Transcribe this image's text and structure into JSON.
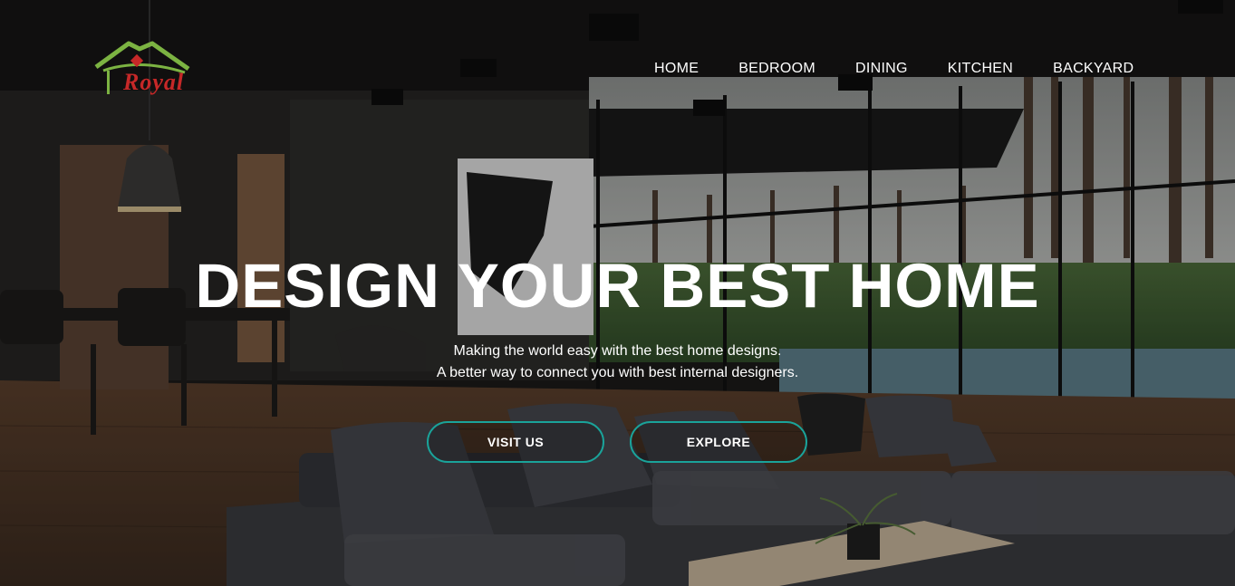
{
  "brand": {
    "logo_text": "Royal",
    "logo_roof_color": "#7cb342",
    "logo_text_color": "#c62828"
  },
  "nav": {
    "items": [
      {
        "label": "HOME"
      },
      {
        "label": "BEDROOM"
      },
      {
        "label": "DINING"
      },
      {
        "label": "KITCHEN"
      },
      {
        "label": "BACKYARD"
      }
    ]
  },
  "hero": {
    "headline": "DESIGN YOUR BEST HOME",
    "subline_1": "Making the world easy with the best home designs.",
    "subline_2": "A better way to connect you with best internal designers.",
    "buttons": {
      "visit_label": "VISIT US",
      "explore_label": "EXPLORE"
    },
    "accent_color": "#1aa39a",
    "background_image": "dark living room interior with grey sectional sofa, wooden floor, glass wall to garden and pool"
  }
}
